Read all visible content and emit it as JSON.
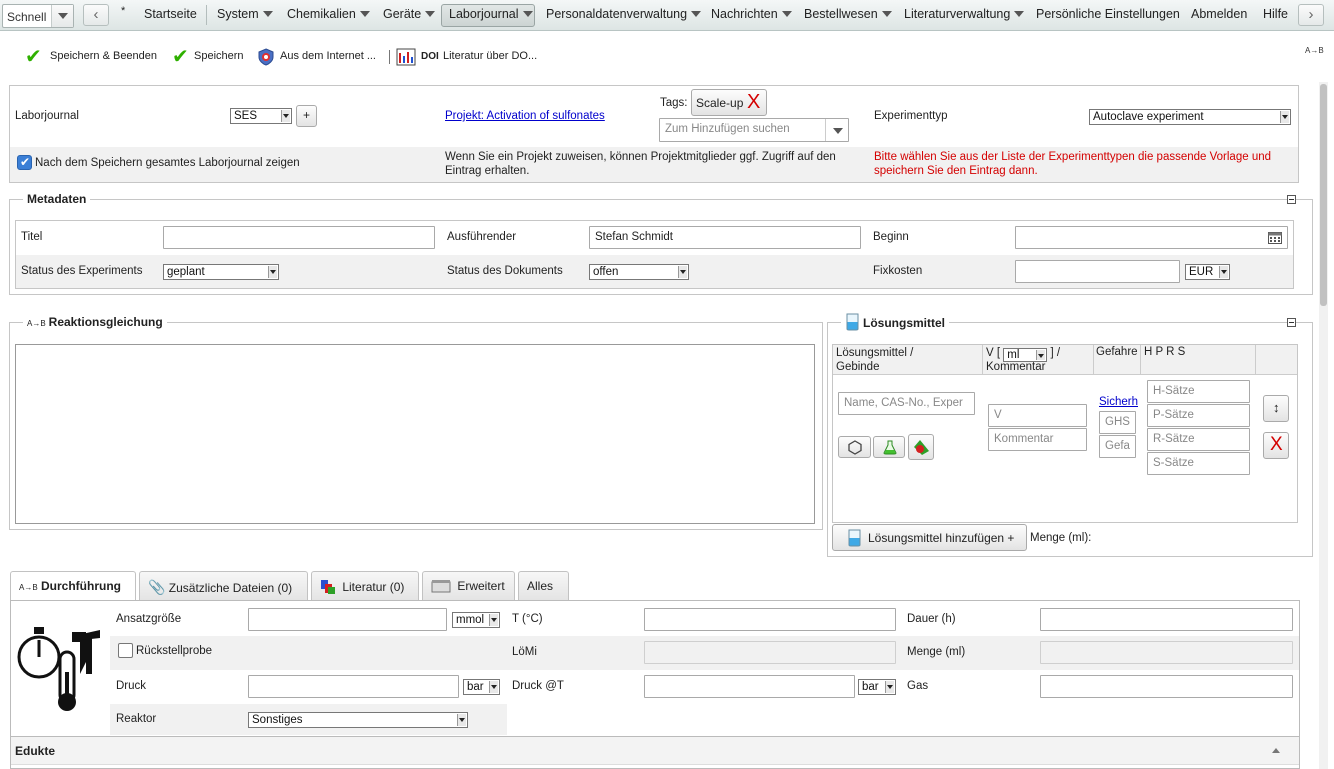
{
  "nav": {
    "quick": "Schnell",
    "prev_icon": "chevron-left-icon",
    "next_icon": "chevron-right-icon",
    "star": "*",
    "items": [
      "Startseite",
      "System",
      "Chemikalien",
      "Geräte",
      "Laborjournal",
      "Personaldatenverwaltung",
      "Nachrichten",
      "Bestellwesen",
      "Literaturverwaltung",
      "Persönliche Einstellungen",
      "Abmelden",
      "Hilfe"
    ],
    "active": "Laborjournal"
  },
  "toolbar": {
    "save_close": "Speichern & Beenden",
    "save": "Speichern",
    "internet": "Aus dem Internet ...",
    "doi_prefix": "DOI",
    "doi": "Literatur über DO...",
    "corner": "A→B"
  },
  "header": {
    "journal_label": "Laborjournal",
    "journal_value": "SES",
    "add": "+",
    "project_link": "Projekt: Activation of sulfonates",
    "tags_label": "Tags:",
    "tag": "Scale-up",
    "tag_remove": "X",
    "tag_search_placeholder": "Zum Hinzufügen suchen",
    "exptype_label": "Experimenttyp",
    "exptype_value": "Autoclave experiment",
    "show_journal": "Nach dem Speichern gesamtes Laborjournal zeigen",
    "project_hint": "Wenn Sie ein Projekt zuweisen, können Projektmitglieder ggf. Zugriff auf den Eintrag erhalten.",
    "type_hint": "Bitte wählen Sie aus der Liste der Experimenttypen die passende Vorlage und speichern Sie den Eintrag dann."
  },
  "meta": {
    "legend": "Metadaten",
    "title_label": "Titel",
    "title_value": "",
    "executor_label": "Ausführender",
    "executor_value": "Stefan Schmidt",
    "begin_label": "Beginn",
    "begin_value": "",
    "status_exp_label": "Status des Experiments",
    "status_exp_value": "geplant",
    "status_doc_label": "Status des Dokuments",
    "status_doc_value": "offen",
    "fixcost_label": "Fixkosten",
    "fixcost_value": "",
    "currency": "EUR"
  },
  "reaction": {
    "prefix": "A→B",
    "legend": "Reaktionsgleichung"
  },
  "solvents": {
    "legend": "Lösungsmittel",
    "col_name": "Lösungsmittel / Gebinde",
    "col_v_pre": "V [",
    "col_v_unit": "ml",
    "col_v_post": "] / Kommentar",
    "col_hazard": "Gefahre",
    "col_hprs": "H P R S",
    "name_placeholder": "Name, CAS-No., Exper",
    "v_placeholder": "V",
    "comment_placeholder": "Kommentar",
    "safety_link": "Sicherh",
    "ghs_placeholder": "GHS",
    "hazard_placeholder": "Gefa",
    "h_placeholder": "H-Sätze",
    "p_placeholder": "P-Sätze",
    "r_placeholder": "R-Sätze",
    "s_placeholder": "S-Sätze",
    "remove": "X",
    "add_button": "Lösungsmittel hinzufügen +",
    "amount_label": "Menge (ml):"
  },
  "tabs": {
    "items": [
      "Durchführung",
      "Zusätzliche Dateien (0)",
      "Literatur (0)",
      "Erweitert",
      "Alles"
    ],
    "active_prefix": "A→B"
  },
  "execution": {
    "batch_label": "Ansatzgröße",
    "batch_value": "",
    "batch_unit": "mmol",
    "temp_label": "T (°C)",
    "temp_value": "",
    "duration_label": "Dauer (h)",
    "duration_value": "",
    "retain_label": "Rückstellprobe",
    "solvent_label": "LöMi",
    "amount_label": "Menge (ml)",
    "pressure_label": "Druck",
    "pressure_value": "",
    "pressure_unit": "bar",
    "pressure_t_label": "Druck @T",
    "pressure_t_value": "",
    "pressure_t_unit": "bar",
    "gas_label": "Gas",
    "gas_value": "",
    "reactor_label": "Reaktor",
    "reactor_value": "Sonstiges"
  },
  "educts": {
    "title": "Edukte"
  },
  "colors": {
    "check": "#2fb000",
    "warning": "#d40000",
    "link": "#0000cc",
    "nav_bg": "#dde5e4"
  }
}
